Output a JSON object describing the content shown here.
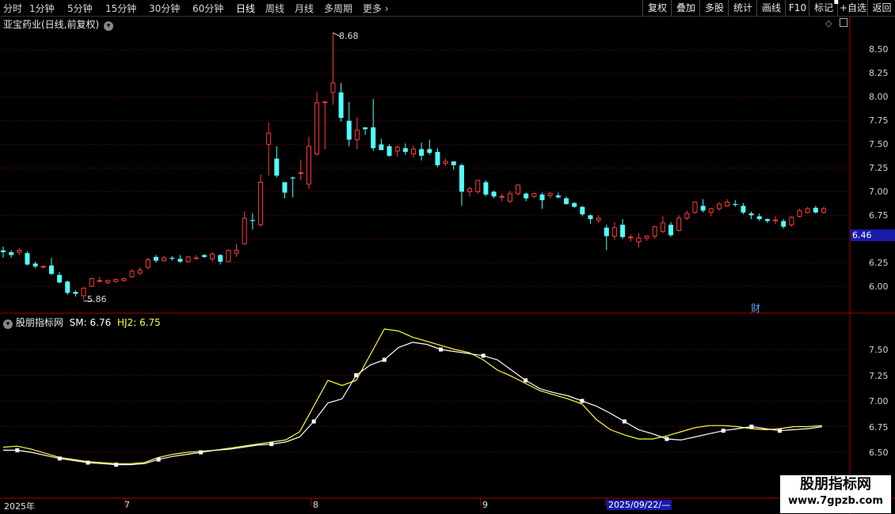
{
  "toolbar": {
    "periods": [
      "分时",
      "1分钟",
      "5分钟",
      "15分钟",
      "30分钟",
      "60分钟",
      "日线",
      "周线",
      "月线",
      "多周期",
      "更多"
    ],
    "active_period": "日线",
    "actions": [
      "复权",
      "叠加",
      "多股",
      "统计",
      "画线",
      "F10",
      "标记",
      "+自选",
      "返回"
    ]
  },
  "stock": {
    "title": "亚宝药业(日线,前复权)",
    "high_label": "8.68",
    "low_label": "5.86",
    "current_price_tag": "6.46",
    "event_marker": "财"
  },
  "indicator": {
    "name": "股朋指标网",
    "sm_label": "SM: 6.76",
    "hj2_label": "HJ2: 6.75"
  },
  "axis": {
    "price_ticks": [
      "8.50",
      "8.25",
      "8.00",
      "7.75",
      "7.50",
      "7.25",
      "7.00",
      "6.75",
      "6.25",
      "6.00"
    ],
    "indicator_ticks": [
      "7.50",
      "7.25",
      "7.00",
      "6.75",
      "6.50"
    ]
  },
  "dates": {
    "year": "2025年",
    "months": [
      "7",
      "8",
      "9"
    ],
    "cursor_date": "2025/09/22/—"
  },
  "watermark": {
    "title": "股朋指标网",
    "url": "www.7gpzb.com"
  },
  "colors": {
    "up": "#ff3c3c",
    "down": "#54fcfc",
    "grid": "#7a0000",
    "sm_line": "#ffffff",
    "hj2_line": "#ffff3c",
    "tag_bg": "#1a1aa8"
  },
  "chart_data": {
    "type": "candlestick",
    "candles": [
      [
        6.38,
        6.36,
        6.42,
        6.3
      ],
      [
        6.36,
        6.33,
        6.38,
        6.3
      ],
      [
        6.36,
        6.38,
        6.4,
        6.33
      ],
      [
        6.35,
        6.23,
        6.37,
        6.22
      ],
      [
        6.24,
        6.21,
        6.26,
        6.19
      ],
      [
        6.21,
        6.21,
        6.22,
        6.19
      ],
      [
        6.22,
        6.13,
        6.3,
        6.12
      ],
      [
        6.12,
        6.04,
        6.15,
        6.03
      ],
      [
        6.05,
        5.93,
        6.06,
        5.91
      ],
      [
        5.94,
        5.92,
        5.96,
        5.89
      ],
      [
        5.9,
        5.98,
        5.99,
        5.86
      ],
      [
        6.0,
        6.08,
        6.09,
        5.99
      ],
      [
        6.06,
        6.06,
        6.1,
        6.04
      ],
      [
        6.04,
        6.06,
        6.07,
        6.02
      ],
      [
        6.05,
        6.07,
        6.08,
        6.04
      ],
      [
        6.06,
        6.08,
        6.09,
        6.05
      ],
      [
        6.1,
        6.16,
        6.18,
        6.09
      ],
      [
        6.14,
        6.17,
        6.2,
        6.12
      ],
      [
        6.2,
        6.28,
        6.3,
        6.18
      ],
      [
        6.31,
        6.27,
        6.33,
        6.25
      ],
      [
        6.27,
        6.3,
        6.32,
        6.26
      ],
      [
        6.3,
        6.29,
        6.32,
        6.27
      ],
      [
        6.29,
        6.26,
        6.33,
        6.25
      ],
      [
        6.26,
        6.31,
        6.32,
        6.25
      ],
      [
        6.3,
        6.3,
        6.33,
        6.29
      ],
      [
        6.33,
        6.31,
        6.34,
        6.3
      ],
      [
        6.29,
        6.34,
        6.36,
        6.26
      ],
      [
        6.33,
        6.26,
        6.34,
        6.23
      ],
      [
        6.26,
        6.38,
        6.39,
        6.26
      ],
      [
        6.35,
        6.38,
        6.45,
        6.31
      ],
      [
        6.45,
        6.72,
        6.79,
        6.44
      ],
      [
        6.7,
        6.69,
        6.77,
        6.6
      ],
      [
        6.65,
        7.1,
        7.18,
        6.63
      ],
      [
        7.5,
        7.62,
        7.73,
        7.17
      ],
      [
        7.35,
        7.17,
        7.48,
        7.15
      ],
      [
        7.1,
        6.99,
        7.1,
        6.93
      ],
      [
        7.15,
        7.14,
        7.16,
        6.94
      ],
      [
        7.2,
        7.2,
        7.34,
        7.12
      ],
      [
        7.08,
        7.48,
        7.58,
        7.03
      ],
      [
        7.4,
        7.94,
        8.05,
        7.38
      ],
      [
        7.95,
        7.95,
        7.95,
        7.45
      ],
      [
        8.05,
        8.15,
        8.68,
        7.92
      ],
      [
        8.05,
        7.78,
        8.15,
        7.74
      ],
      [
        7.75,
        7.55,
        7.95,
        7.48
      ],
      [
        7.55,
        7.65,
        7.79,
        7.45
      ],
      [
        7.68,
        7.66,
        7.68,
        7.6
      ],
      [
        7.68,
        7.46,
        7.98,
        7.43
      ],
      [
        7.5,
        7.44,
        7.56,
        7.44
      ],
      [
        7.48,
        7.38,
        7.5,
        7.37
      ],
      [
        7.43,
        7.47,
        7.49,
        7.37
      ],
      [
        7.46,
        7.42,
        7.51,
        7.39
      ],
      [
        7.4,
        7.45,
        7.49,
        7.36
      ],
      [
        7.45,
        7.38,
        7.52,
        7.33
      ],
      [
        7.45,
        7.41,
        7.55,
        7.39
      ],
      [
        7.42,
        7.28,
        7.46,
        7.26
      ],
      [
        7.3,
        7.32,
        7.35,
        7.27
      ],
      [
        7.32,
        7.28,
        7.32,
        7.23
      ],
      [
        7.28,
        7.0,
        7.3,
        6.85
      ],
      [
        7.0,
        7.03,
        7.05,
        6.95
      ],
      [
        7.0,
        7.12,
        7.12,
        6.98
      ],
      [
        7.1,
        6.97,
        7.12,
        6.95
      ],
      [
        7.0,
        6.95,
        7.01,
        6.93
      ],
      [
        6.95,
        6.95,
        6.98,
        6.9
      ],
      [
        6.9,
        6.98,
        7.01,
        6.88
      ],
      [
        6.98,
        7.07,
        7.08,
        6.96
      ],
      [
        6.98,
        6.93,
        6.99,
        6.9
      ],
      [
        6.95,
        6.98,
        6.99,
        6.93
      ],
      [
        6.97,
        6.91,
        6.99,
        6.82
      ],
      [
        6.96,
        6.98,
        7.0,
        6.93
      ],
      [
        6.96,
        6.94,
        6.99,
        6.93
      ],
      [
        6.93,
        6.87,
        6.95,
        6.86
      ],
      [
        6.88,
        6.84,
        6.89,
        6.83
      ],
      [
        6.84,
        6.76,
        6.85,
        6.74
      ],
      [
        6.75,
        6.71,
        6.76,
        6.66
      ],
      [
        6.7,
        6.72,
        6.75,
        6.67
      ],
      [
        6.62,
        6.53,
        6.65,
        6.38
      ],
      [
        6.53,
        6.62,
        6.68,
        6.49
      ],
      [
        6.65,
        6.52,
        6.71,
        6.5
      ],
      [
        6.52,
        6.52,
        6.55,
        6.47
      ],
      [
        6.47,
        6.51,
        6.56,
        6.41
      ],
      [
        6.51,
        6.53,
        6.54,
        6.48
      ],
      [
        6.53,
        6.63,
        6.64,
        6.5
      ],
      [
        6.58,
        6.67,
        6.74,
        6.56
      ],
      [
        6.65,
        6.54,
        6.68,
        6.52
      ],
      [
        6.59,
        6.72,
        6.75,
        6.58
      ],
      [
        6.72,
        6.77,
        6.8,
        6.7
      ],
      [
        6.78,
        6.89,
        6.89,
        6.77
      ],
      [
        6.85,
        6.8,
        6.92,
        6.78
      ],
      [
        6.78,
        6.82,
        6.83,
        6.74
      ],
      [
        6.82,
        6.87,
        6.89,
        6.8
      ],
      [
        6.85,
        6.89,
        6.92,
        6.84
      ],
      [
        6.87,
        6.86,
        6.91,
        6.84
      ],
      [
        6.85,
        6.78,
        6.88,
        6.76
      ],
      [
        6.77,
        6.75,
        6.79,
        6.71
      ],
      [
        6.74,
        6.71,
        6.77,
        6.69
      ],
      [
        6.71,
        6.69,
        6.72,
        6.67
      ],
      [
        6.7,
        6.7,
        6.74,
        6.66
      ],
      [
        6.69,
        6.63,
        6.71,
        6.61
      ],
      [
        6.65,
        6.73,
        6.74,
        6.63
      ],
      [
        6.74,
        6.8,
        6.82,
        6.73
      ],
      [
        6.78,
        6.82,
        6.84,
        6.77
      ],
      [
        6.83,
        6.78,
        6.85,
        6.77
      ],
      [
        6.78,
        6.82,
        6.84,
        6.77
      ]
    ],
    "price_ylim": [
      5.8,
      8.8
    ],
    "indicator_ylim": [
      6.37,
      7.8
    ],
    "sm_values": [
      6.52,
      6.52,
      6.5,
      6.47,
      6.44,
      6.42,
      6.4,
      6.39,
      6.38,
      6.38,
      6.39,
      6.43,
      6.46,
      6.48,
      6.5,
      6.52,
      6.53,
      6.55,
      6.57,
      6.58,
      6.6,
      6.65,
      6.8,
      6.98,
      7.02,
      7.25,
      7.35,
      7.4,
      7.52,
      7.57,
      7.55,
      7.5,
      7.48,
      7.46,
      7.44,
      7.4,
      7.3,
      7.2,
      7.12,
      7.08,
      7.05,
      7.0,
      6.95,
      6.88,
      6.8,
      6.72,
      6.68,
      6.63,
      6.62,
      6.65,
      6.68,
      6.71,
      6.73,
      6.75,
      6.73,
      6.71,
      6.72,
      6.73,
      6.75
    ],
    "hj2_values": [
      6.55,
      6.56,
      6.53,
      6.49,
      6.45,
      6.43,
      6.41,
      6.4,
      6.39,
      6.39,
      6.4,
      6.45,
      6.48,
      6.5,
      6.51,
      6.52,
      6.54,
      6.56,
      6.58,
      6.6,
      6.62,
      6.7,
      6.95,
      7.2,
      7.15,
      7.2,
      7.45,
      7.7,
      7.68,
      7.62,
      7.58,
      7.54,
      7.5,
      7.47,
      7.4,
      7.3,
      7.24,
      7.17,
      7.1,
      7.06,
      7.02,
      6.97,
      6.82,
      6.72,
      6.67,
      6.63,
      6.63,
      6.66,
      6.7,
      6.74,
      6.76,
      6.76,
      6.75,
      6.73,
      6.72,
      6.73,
      6.75,
      6.75,
      6.76
    ],
    "sm_markers": [
      1,
      4,
      6,
      8,
      11,
      14,
      19,
      22,
      25,
      27,
      31,
      34,
      37,
      41,
      44,
      47,
      51,
      53,
      55,
      59
    ]
  }
}
